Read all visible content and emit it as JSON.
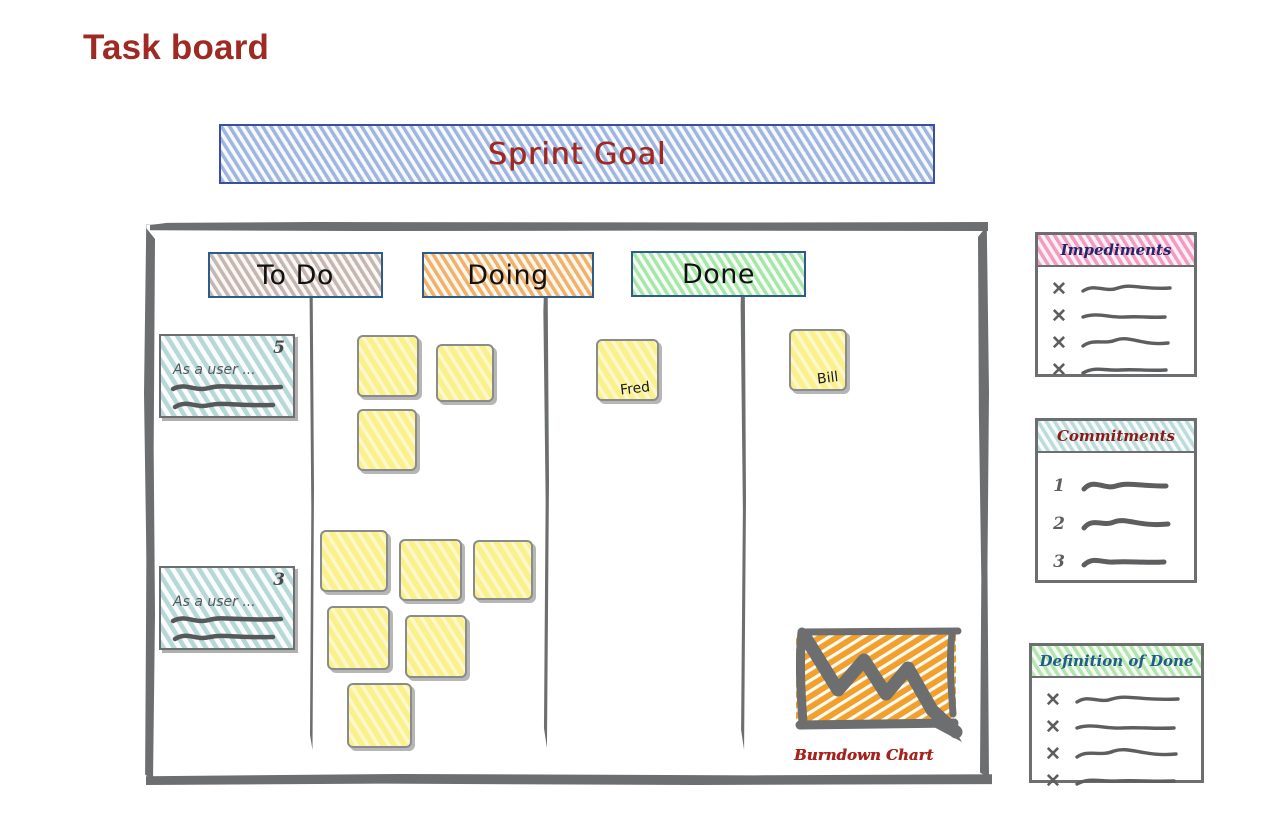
{
  "page": {
    "title": "Task board"
  },
  "sprint_goal": {
    "label": "Sprint Goal",
    "fill_color": "#9FB7E0",
    "border_color": "#3B4FA0",
    "text_color": "#9E2A23"
  },
  "board": {
    "columns": [
      {
        "id": "todo",
        "label": "To Do",
        "fill_color": "#C6B6B0",
        "border_color": "#2E5C8A"
      },
      {
        "id": "doing",
        "label": "Doing",
        "fill_color": "#F0B16B",
        "border_color": "#2E5C8A"
      },
      {
        "id": "done",
        "label": "Done",
        "fill_color": "#A6E7A8",
        "border_color": "#2E5C8A"
      }
    ],
    "stories": [
      {
        "points": "5",
        "text": "As a user ...",
        "fill_color": "#B7D8D8"
      },
      {
        "points": "3",
        "text": "As a user ...",
        "fill_color": "#B7D8D8"
      }
    ],
    "task_notes": {
      "todo": [
        {
          "owner": ""
        },
        {
          "owner": ""
        },
        {
          "owner": ""
        },
        {
          "owner": ""
        },
        {
          "owner": ""
        },
        {
          "owner": ""
        },
        {
          "owner": ""
        },
        {
          "owner": ""
        },
        {
          "owner": ""
        }
      ],
      "doing": [
        {
          "owner": "Fred"
        }
      ],
      "done": [
        {
          "owner": "Bill"
        }
      ]
    },
    "note_color": "#FAF08C",
    "frame_color": "#6d6e70"
  },
  "burndown": {
    "label": "Burndown Chart",
    "fill_color": "#F0A02B",
    "line_color": "#6d6e70",
    "text_color": "#A5231C"
  },
  "panels": [
    {
      "id": "impediments",
      "title": "Impediments",
      "header_color": "#F29CC2",
      "title_color": "#23256B",
      "rows": [
        {
          "mark": "✕"
        },
        {
          "mark": "✕"
        },
        {
          "mark": "✕"
        },
        {
          "mark": "✕"
        }
      ]
    },
    {
      "id": "commitments",
      "title": "Commitments",
      "header_color": "#BCDCDC",
      "title_color": "#8B1A17",
      "rows": [
        {
          "mark": "1"
        },
        {
          "mark": "2"
        },
        {
          "mark": "3"
        }
      ]
    },
    {
      "id": "definition-of-done",
      "title": "Definition of Done",
      "header_color": "#B3E5AE",
      "title_color": "#1F5C86",
      "rows": [
        {
          "mark": "✕"
        },
        {
          "mark": "✕"
        },
        {
          "mark": "✕"
        },
        {
          "mark": "✕"
        }
      ]
    }
  ]
}
